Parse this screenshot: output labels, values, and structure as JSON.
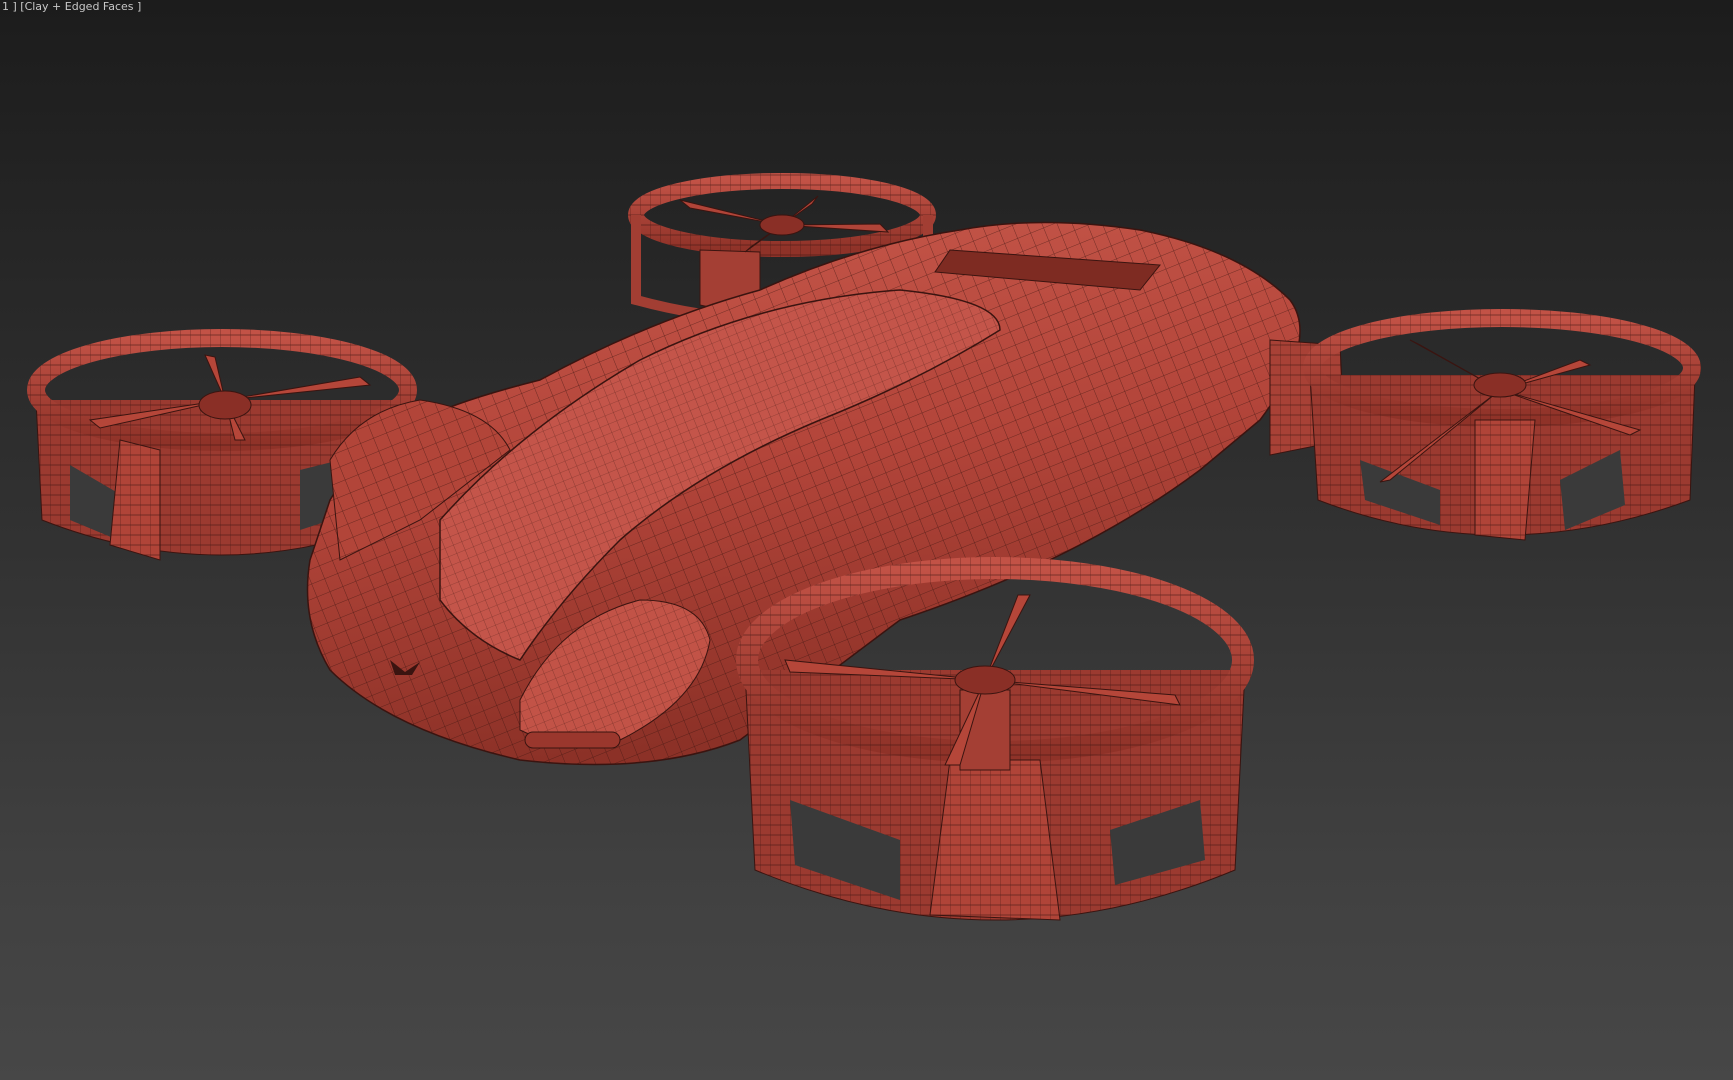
{
  "viewport": {
    "label": "1 ] [Clay + Edged Faces ]",
    "background_top_color": "#1c1c1c",
    "background_bottom_color": "#474747"
  },
  "model": {
    "material_color": "#b5463a",
    "wire_color": "#3a1410"
  }
}
